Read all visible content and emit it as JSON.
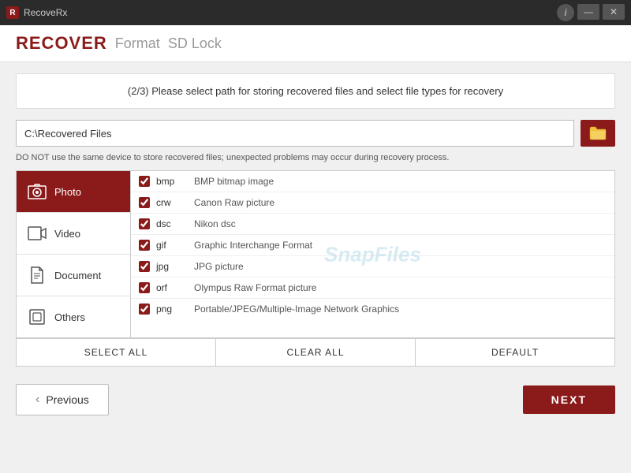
{
  "titlebar": {
    "app_name": "RecoveRx",
    "info_label": "i",
    "minimize_label": "—",
    "close_label": "✕"
  },
  "nav": {
    "recover_label": "RECOVER",
    "format_label": "Format",
    "sdlock_label": "SD Lock"
  },
  "step": {
    "description": "(2/3) Please select path for storing recovered files and select file types for recovery"
  },
  "path": {
    "value": "C:\\Recovered Files",
    "placeholder": "C:\\Recovered Files"
  },
  "warning": {
    "text": "DO NOT use the same device to store recovered files; unexpected problems may occur during recovery process."
  },
  "categories": [
    {
      "id": "photo",
      "label": "Photo",
      "icon": "🖼",
      "active": true
    },
    {
      "id": "video",
      "label": "Video",
      "icon": "▶",
      "active": false
    },
    {
      "id": "document",
      "label": "Document",
      "icon": "📄",
      "active": false
    },
    {
      "id": "others",
      "label": "Others",
      "icon": "⬜",
      "active": false
    }
  ],
  "files": [
    {
      "checked": true,
      "ext": "bmp",
      "desc": "BMP bitmap image"
    },
    {
      "checked": true,
      "ext": "crw",
      "desc": "Canon Raw picture"
    },
    {
      "checked": true,
      "ext": "dsc",
      "desc": "Nikon dsc"
    },
    {
      "checked": true,
      "ext": "gif",
      "desc": "Graphic Interchange Format"
    },
    {
      "checked": true,
      "ext": "jpg",
      "desc": "JPG picture"
    },
    {
      "checked": true,
      "ext": "orf",
      "desc": "Olympus Raw Format picture"
    },
    {
      "checked": true,
      "ext": "png",
      "desc": "Portable/JPEG/Multiple-Image Network Graphics"
    }
  ],
  "watermark": "SnapFiles",
  "buttons": {
    "select_all": "SELECT ALL",
    "clear_all": "CLEAR ALL",
    "default": "DEFAULT",
    "previous": "Previous",
    "next": "NEXT"
  }
}
